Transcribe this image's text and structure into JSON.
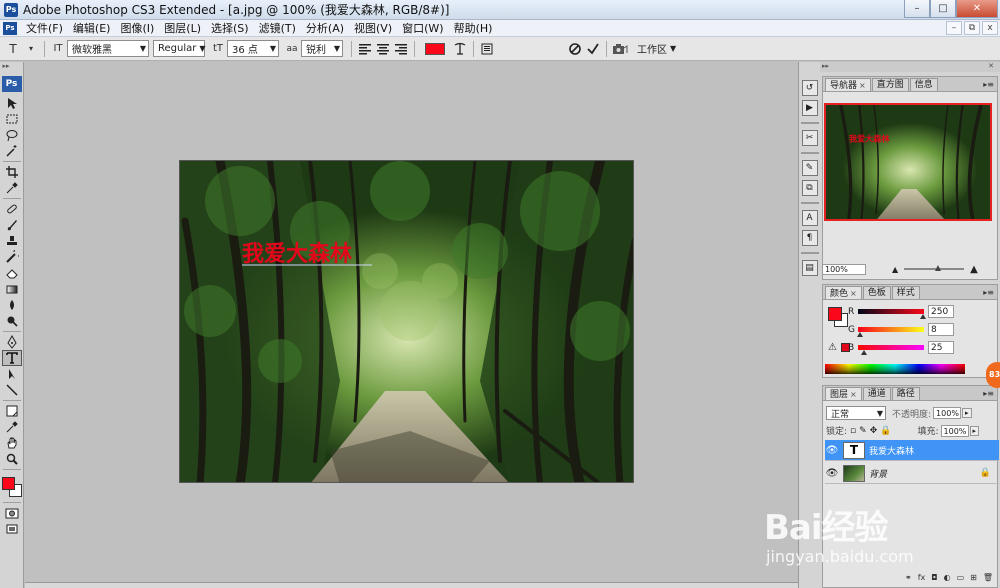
{
  "window": {
    "app_icon": "Ps",
    "title": "Adobe Photoshop CS3 Extended - [a.jpg @ 100% (我爱大森林, RGB/8#)]",
    "controls": {
      "minimize": "–",
      "maximize": "□",
      "close": "✕"
    }
  },
  "menu": {
    "ps_icon": "Ps",
    "items": [
      "文件(F)",
      "编辑(E)",
      "图像(I)",
      "图层(L)",
      "选择(S)",
      "滤镜(T)",
      "分析(A)",
      "视图(V)",
      "窗口(W)",
      "帮助(H)"
    ],
    "doc_controls": {
      "minimize": "–",
      "restore": "⧉",
      "close": "x"
    }
  },
  "options": {
    "tool_icon": "T",
    "orient_icon": "IT",
    "font_family": "微软雅黑",
    "font_style": "Regular",
    "size_icon": "tT",
    "font_size": "36 点",
    "aa_icon": "aa",
    "antialias": "锐利",
    "text_color": "#fa0819",
    "workspace_label": "工作区",
    "align": [
      "left",
      "center",
      "right"
    ]
  },
  "toolbar": {
    "logo": "Ps",
    "fg_color": "#fa0819",
    "bg_color": "#ffffff"
  },
  "canvas": {
    "overlay_text": "我爱大森林",
    "overlay_color": "#e3071b"
  },
  "navigator": {
    "tabs": [
      "导航器",
      "直方图",
      "信息"
    ],
    "zoom": "100%",
    "zoom_fraction": 0.57
  },
  "color_panel": {
    "tabs": [
      "颜色",
      "色板",
      "样式"
    ],
    "r_label": "R",
    "g_label": "G",
    "b_label": "B",
    "r": "250",
    "g": "8",
    "b": "25",
    "current": "#fa0819"
  },
  "layers_panel": {
    "tabs": [
      "图层",
      "通道",
      "路径"
    ],
    "blend_mode": "正常",
    "opacity_label": "不透明度:",
    "opacity": "100%",
    "lock_label": "锁定:",
    "fill_label": "填充:",
    "fill": "100%",
    "layers": [
      {
        "name": "我爱大森林",
        "thumb": "T",
        "selected": true
      },
      {
        "name": "背景",
        "thumb": "",
        "selected": false
      }
    ]
  },
  "badge": "83",
  "watermark": {
    "logo": "Bai经验",
    "sub": "jingyan.baidu.com"
  }
}
